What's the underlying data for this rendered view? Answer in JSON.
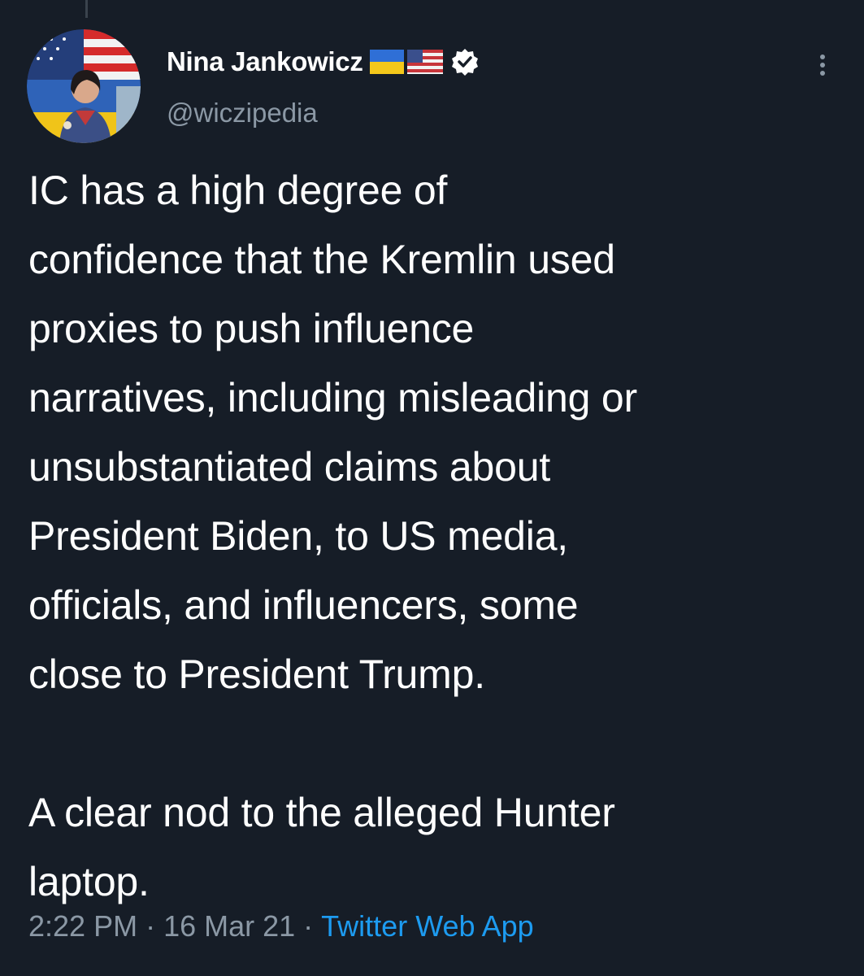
{
  "tweet": {
    "author": {
      "display_name": "Nina Jankowicz",
      "handle": "@wiczipedia",
      "badges": [
        "ukraine-flag-icon",
        "us-flag-icon",
        "verified-badge-icon"
      ]
    },
    "text_paragraphs": [
      "IC has a high degree of\nconfidence that the Kremlin used\nproxies to push influence\nnarratives, including misleading or\nunsubstantiated claims about\nPresident Biden, to US media,\nofficials, and influencers, some\nclose to President Trump.",
      "A clear nod to the alleged Hunter\nlaptop."
    ],
    "time": "2:22 PM",
    "date": "16 Mar 21",
    "separator": "·",
    "source": "Twitter Web App"
  },
  "colors": {
    "background": "#161d27",
    "text": "#ffffff",
    "secondary_text": "#8b98a5",
    "link": "#1d9bf0"
  }
}
